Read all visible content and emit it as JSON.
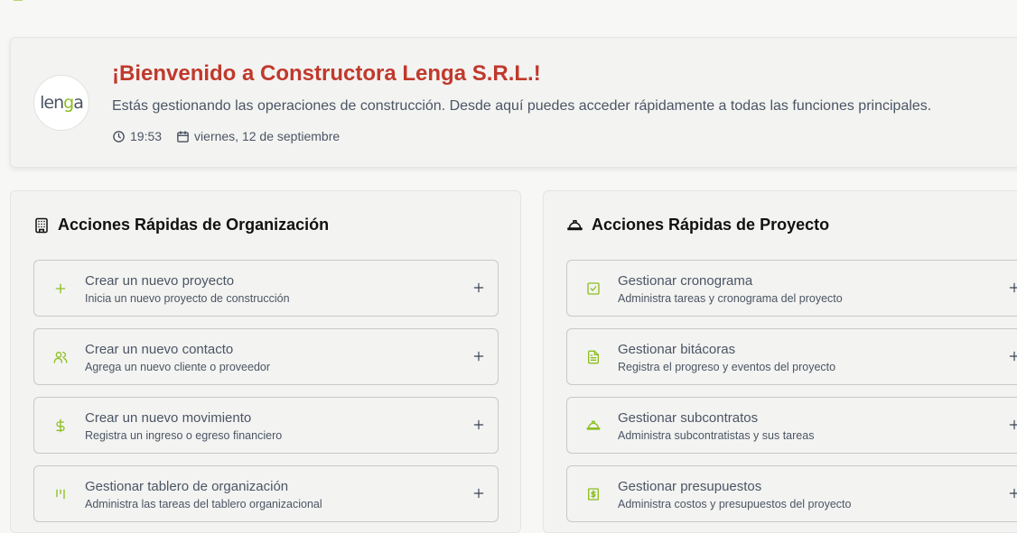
{
  "welcome": {
    "logo_text_a": "len",
    "logo_text_g": "g",
    "logo_text_b": "a",
    "title": "¡Bienvenido a Constructora Lenga S.R.L.!",
    "subtitle": "Estás gestionando las operaciones de construcción. Desde aquí puedes acceder rápidamente a todas las funciones principales.",
    "time": "19:53",
    "date": "viernes, 12 de septiembre"
  },
  "colors": {
    "accent": "#8bbf1f",
    "title_red": "#c0392b"
  },
  "org_actions": {
    "title": "Acciones Rápidas de Organización",
    "items": [
      {
        "icon": "plus-icon",
        "title": "Crear un nuevo proyecto",
        "desc": "Inicia un nuevo proyecto de construcción"
      },
      {
        "icon": "users-icon",
        "title": "Crear un nuevo contacto",
        "desc": "Agrega un nuevo cliente o proveedor"
      },
      {
        "icon": "dollar-icon",
        "title": "Crear un nuevo movimiento",
        "desc": "Registra un ingreso o egreso financiero"
      },
      {
        "icon": "kanban-icon",
        "title": "Gestionar tablero de organización",
        "desc": "Administra las tareas del tablero organizacional"
      }
    ]
  },
  "project_actions": {
    "title": "Acciones Rápidas de Proyecto",
    "items": [
      {
        "icon": "check-square-icon",
        "title": "Gestionar cronograma",
        "desc": "Administra tareas y cronograma del proyecto"
      },
      {
        "icon": "file-text-icon",
        "title": "Gestionar bitácoras",
        "desc": "Registra el progreso y eventos del proyecto"
      },
      {
        "icon": "hard-hat-icon",
        "title": "Gestionar subcontratos",
        "desc": "Administra subcontratistas y sus tareas"
      },
      {
        "icon": "receipt-dollar-icon",
        "title": "Gestionar presupuestos",
        "desc": "Administra costos y presupuestos del proyecto"
      }
    ]
  }
}
